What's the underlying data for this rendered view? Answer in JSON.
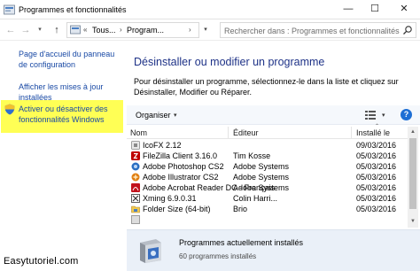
{
  "window": {
    "title": "Programmes et fonctionnalités",
    "minimize": "—",
    "maximize": "☐",
    "close": "✕"
  },
  "address": {
    "back": "←",
    "forward": "→",
    "recent": "▾",
    "up": "↑",
    "crumb_prefix": "«",
    "crumbs": [
      "Tous...",
      "Program..."
    ],
    "separator": "›",
    "dropdown": "▾",
    "refresh": "↻",
    "search_placeholder": "Rechercher dans : Programmes et fonctionnalités"
  },
  "sidebar": {
    "links": [
      "Page d'accueil du panneau de configuration",
      "Afficher les mises à jour installées",
      "Activer ou désactiver des fonctionnalités Windows"
    ],
    "highlight_color": "#ffff55"
  },
  "main": {
    "heading": "Désinstaller ou modifier un programme",
    "description": "Pour désinstaller un programme, sélectionnez-le dans la liste et cliquez sur Désinstaller, Modifier ou Réparer."
  },
  "toolbar": {
    "organiser": "Organiser",
    "caret": "▾",
    "help": "?"
  },
  "table": {
    "columns": [
      "Nom",
      "Éditeur",
      "Installé le"
    ],
    "sort_indicator": "⌃",
    "rows": [
      {
        "name": "IcoFX 2.12",
        "editor": "",
        "installed": "09/03/2016",
        "icon": "icofx-icon",
        "color": "#8a8a8a"
      },
      {
        "name": "FileZilla Client 3.16.0",
        "editor": "Tim Kosse",
        "installed": "05/03/2016",
        "icon": "filezilla-icon",
        "color": "#bf0000"
      },
      {
        "name": "Adobe Photoshop CS2",
        "editor": "Adobe Systems",
        "installed": "05/03/2016",
        "icon": "photoshop-icon",
        "color": "#2a6ec2"
      },
      {
        "name": "Adobe Illustrator CS2",
        "editor": "Adobe Systems",
        "installed": "05/03/2016",
        "icon": "illustrator-icon",
        "color": "#e07d10"
      },
      {
        "name": "Adobe Acrobat Reader DC - Français",
        "editor": "Adobe Systems",
        "installed": "05/03/2016",
        "icon": "acrobat-icon",
        "color": "#c1121c"
      },
      {
        "name": "Xming 6.9.0.31",
        "editor": "Colin Harri...",
        "installed": "05/03/2016",
        "icon": "xming-icon",
        "color": "#333333"
      },
      {
        "name": "Folder Size (64-bit)",
        "editor": "Brio",
        "installed": "05/03/2016",
        "icon": "folder-size-icon",
        "color": "#4a7fc4"
      },
      {
        "name": "",
        "editor": "",
        "installed": "",
        "icon": "program-icon",
        "color": "#888888"
      }
    ]
  },
  "scrollbar": {
    "up": "▲",
    "down": "▼"
  },
  "details": {
    "title": "Programmes actuellement installés",
    "count": "60 programmes installés"
  },
  "watermark": "Easytutoriel.com",
  "colors": {
    "link": "#1a4aa5",
    "heading": "#1e3287",
    "details_bg": "#eaf0f8"
  }
}
